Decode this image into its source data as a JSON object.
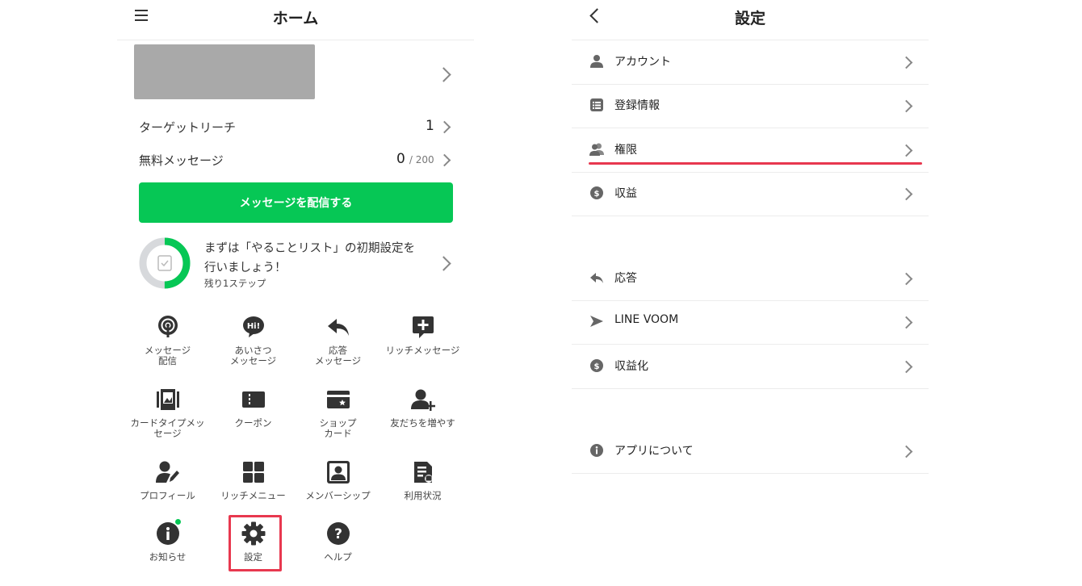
{
  "left": {
    "title": "ホーム",
    "target_reach_label": "ターゲットリーチ",
    "target_reach_value": "1",
    "free_msg_label": "無料メッセージ",
    "free_msg_value": "0",
    "free_msg_max": "/ 200",
    "cta_label": "メッセージを配信する",
    "todo_text_line1": "まずは「やることリスト」の初期設定を",
    "todo_text_line2": "行いましょう！",
    "todo_sub": "残り1ステップ",
    "todo_progress": 0.5,
    "grid": [
      {
        "label": "メッセージ\n配信",
        "icon": "broadcast-icon"
      },
      {
        "label": "あいさつ\nメッセージ",
        "icon": "greeting-icon"
      },
      {
        "label": "応答\nメッセージ",
        "icon": "reply-icon"
      },
      {
        "label": "リッチメッセージ",
        "icon": "rich-message-icon"
      },
      {
        "label": "カードタイプメッ\nセージ",
        "icon": "card-message-icon"
      },
      {
        "label": "クーポン",
        "icon": "coupon-icon"
      },
      {
        "label": "ショップ\nカード",
        "icon": "shop-card-icon"
      },
      {
        "label": "友だちを増やす",
        "icon": "add-friend-icon"
      },
      {
        "label": "プロフィール",
        "icon": "profile-icon"
      },
      {
        "label": "リッチメニュー",
        "icon": "rich-menu-icon"
      },
      {
        "label": "メンバーシップ",
        "icon": "membership-icon"
      },
      {
        "label": "利用状況",
        "icon": "usage-icon"
      },
      {
        "label": "お知らせ",
        "icon": "info-icon"
      },
      {
        "label": "設定",
        "icon": "gear-icon"
      },
      {
        "label": "ヘルプ",
        "icon": "help-icon"
      }
    ]
  },
  "right": {
    "title": "設定",
    "items": [
      {
        "label": "アカウント",
        "icon": "person-icon"
      },
      {
        "label": "登録情報",
        "icon": "list-icon"
      },
      {
        "label": "権限",
        "icon": "users-icon"
      },
      {
        "label": "収益",
        "icon": "dollar-icon"
      },
      {
        "label": "応答",
        "icon": "reply-icon"
      },
      {
        "label": "LINE VOOM",
        "icon": "voom-icon"
      },
      {
        "label": "収益化",
        "icon": "dollar-icon"
      },
      {
        "label": "アプリについて",
        "icon": "info-icon"
      }
    ]
  },
  "colors": {
    "accent_green": "#06c755",
    "highlight_red": "#e8384f",
    "icon_dark": "#333333"
  }
}
